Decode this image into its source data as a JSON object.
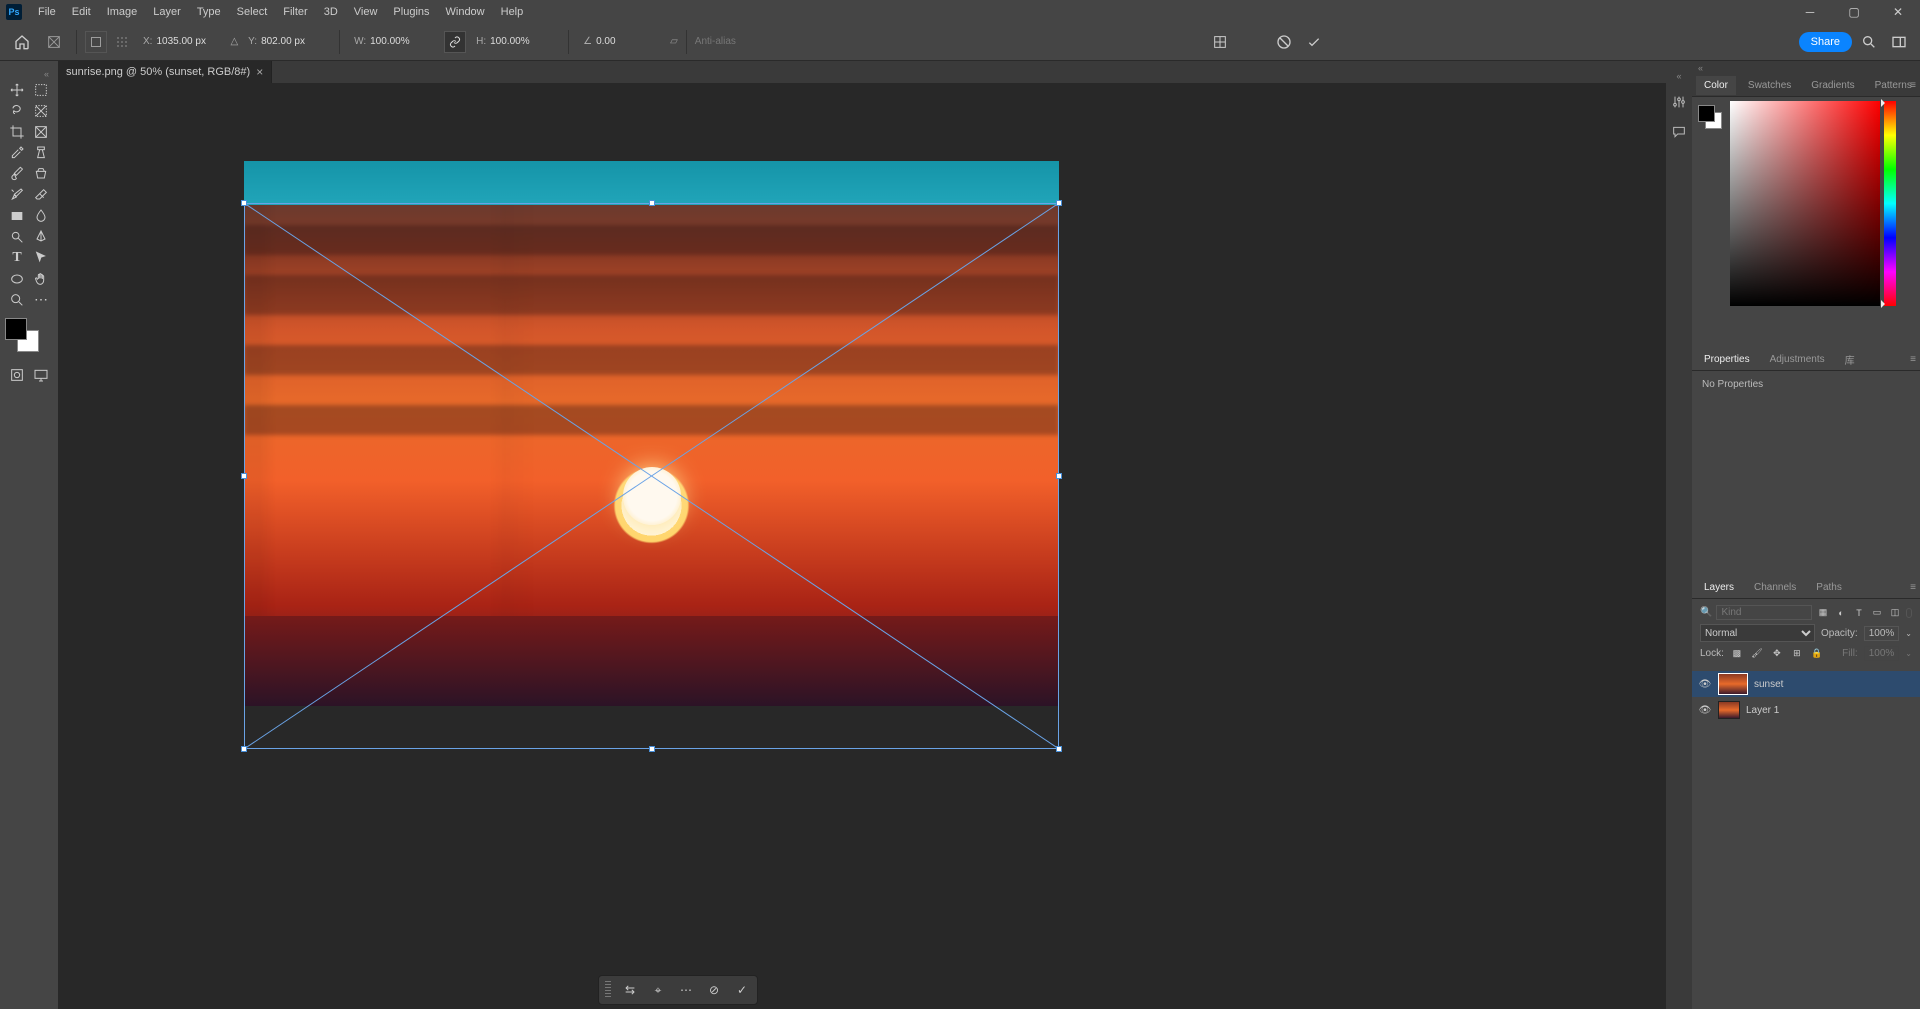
{
  "app": {
    "logo": "Ps"
  },
  "menu": {
    "items": [
      "File",
      "Edit",
      "Image",
      "Layer",
      "Type",
      "Select",
      "Filter",
      "3D",
      "View",
      "Plugins",
      "Window",
      "Help"
    ]
  },
  "options": {
    "x_label": "X:",
    "x_value": "1035.00 px",
    "y_label": "Y:",
    "y_value": "802.00 px",
    "w_label": "W:",
    "w_value": "100.00%",
    "h_label": "H:",
    "h_value": "100.00%",
    "angle_label": "∠",
    "angle_value": "0.00",
    "antialias": "Anti-alias",
    "share": "Share"
  },
  "colors": {
    "foreground": "#000000",
    "background": "#ffffff"
  },
  "document": {
    "tab_title": "sunrise.png @ 50% (sunset, RGB/8#)"
  },
  "panels": {
    "color_tabs": [
      "Color",
      "Swatches",
      "Gradients",
      "Patterns"
    ],
    "properties_tabs": [
      "Properties",
      "Adjustments",
      "库"
    ],
    "properties_body": "No Properties",
    "layers_tabs": [
      "Layers",
      "Channels",
      "Paths"
    ],
    "layer_search_placeholder": "Kind",
    "blend_mode": "Normal",
    "opacity_label": "Opacity:",
    "opacity_value": "100%",
    "lock_label": "Lock:",
    "fill_label": "Fill:",
    "fill_value": "100%"
  },
  "layers": [
    {
      "name": "sunset",
      "active": true
    },
    {
      "name": "Layer 1",
      "active": false
    }
  ]
}
